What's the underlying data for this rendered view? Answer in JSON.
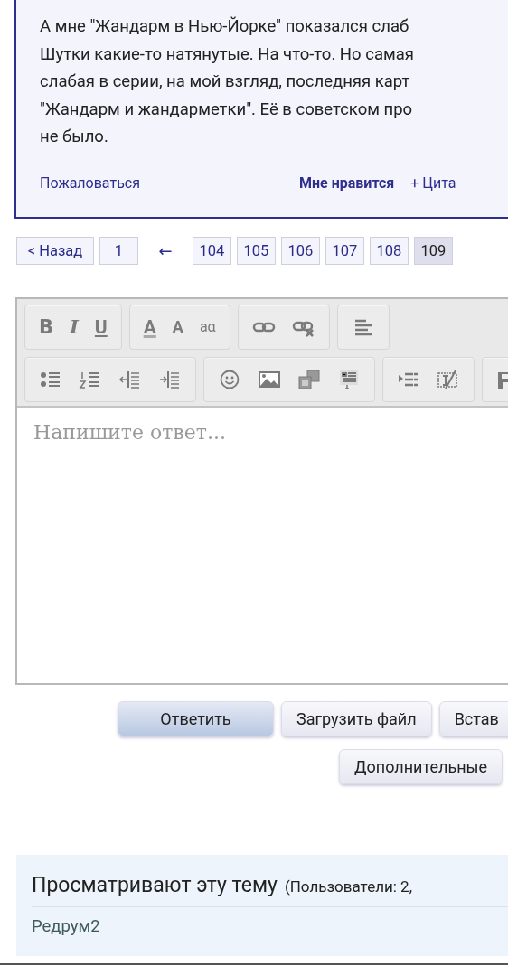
{
  "post": {
    "lines": [
      "А мне \"Жандарм в Нью-Йорке\" показался слаб",
      "Шутки какие-то натянутые. На что-то. Но самая",
      "слабая в серии, на мой взгляд, последняя карт",
      "\"Жандарм и жандарметки\". Её в советском про",
      "не было."
    ],
    "report_link": "Пожаловаться",
    "like_link": "Мне нравится",
    "quote_link": "+ Цита"
  },
  "pagination": {
    "back": "< Назад",
    "pages": [
      {
        "label": "1",
        "selected": false
      },
      {
        "kind": "gap",
        "label": "←"
      },
      {
        "label": "104",
        "selected": false
      },
      {
        "label": "105",
        "selected": false
      },
      {
        "label": "106",
        "selected": false
      },
      {
        "label": "107",
        "selected": false
      },
      {
        "label": "108",
        "selected": false
      },
      {
        "label": "109",
        "selected": true
      }
    ]
  },
  "editor": {
    "toolbar_rows": [
      [
        [
          {
            "kind": "bold",
            "label": "B"
          },
          {
            "kind": "italic",
            "label": "I"
          },
          {
            "kind": "underline",
            "label": "U"
          }
        ],
        [
          {
            "kind": "color",
            "label": "A"
          },
          {
            "kind": "size",
            "label": "A"
          },
          {
            "kind": "translit",
            "label": "aα"
          }
        ],
        [
          {
            "kind": "link"
          },
          {
            "kind": "unlink"
          }
        ],
        [
          {
            "kind": "align"
          }
        ]
      ],
      [
        [
          {
            "kind": "bullets"
          },
          {
            "kind": "numbers"
          },
          {
            "kind": "outdent"
          },
          {
            "kind": "indent"
          }
        ],
        [
          {
            "kind": "smiley"
          },
          {
            "kind": "image"
          },
          {
            "kind": "media"
          },
          {
            "kind": "template"
          }
        ],
        [
          {
            "kind": "spoiler"
          },
          {
            "kind": "clear"
          }
        ],
        [
          {
            "kind": "save"
          }
        ]
      ]
    ],
    "placeholder": "Напишите ответ..."
  },
  "actions": {
    "row_1": [
      {
        "label": "Ответить",
        "kind": "primary"
      },
      {
        "label": "Загрузить файл",
        "kind": "normal"
      },
      {
        "label": "Встав",
        "kind": "normal"
      }
    ],
    "row_2": [
      {
        "label": "Дополнительные"
      }
    ]
  },
  "viewers": {
    "title": "Просматривают эту тему",
    "counts": "(Пользователи: 2,",
    "users": [
      "Редрум2"
    ]
  }
}
